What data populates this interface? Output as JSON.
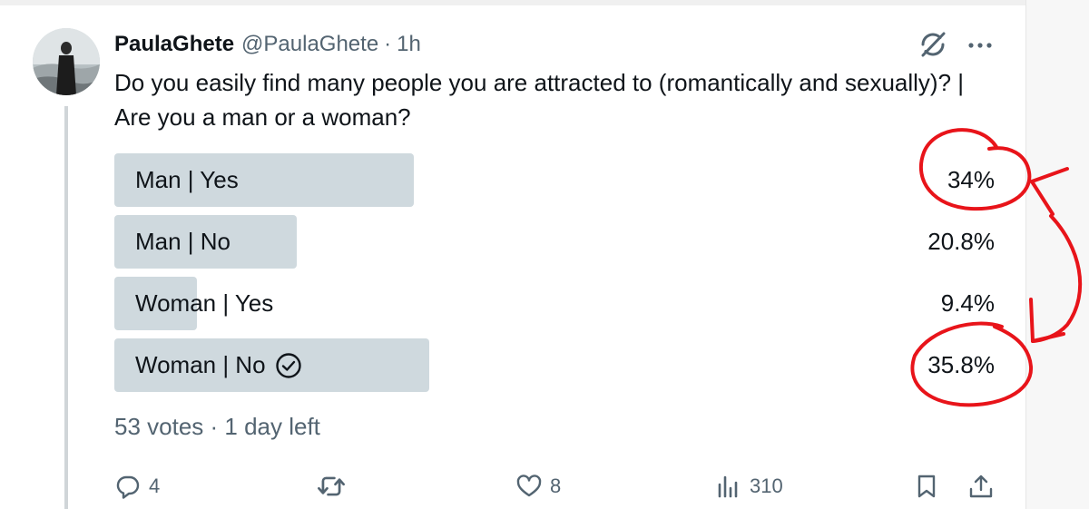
{
  "tweet": {
    "display_name": "PaulaGhete",
    "handle": "@PaulaGhete",
    "separator": "·",
    "time": "1h",
    "text": "Do you easily find many people you are attracted to (romantically and sexually)? | Are you a man or a woman?"
  },
  "poll": {
    "options": [
      {
        "label": "Man | Yes",
        "percent_text": "34%",
        "percent": 34.0
      },
      {
        "label": "Man | No",
        "percent_text": "20.8%",
        "percent": 20.8
      },
      {
        "label": "Woman | Yes",
        "percent_text": "9.4%",
        "percent": 9.4
      },
      {
        "label": "Woman | No",
        "percent_text": "35.8%",
        "percent": 35.8,
        "selected": true
      }
    ],
    "meta": "53 votes · 1 day left"
  },
  "actions": {
    "reply_count": "4",
    "like_count": "8",
    "views_count": "310"
  },
  "icons": {
    "grok": "grok-icon",
    "more": "more-icon",
    "reply": "reply-icon",
    "retweet": "retweet-icon",
    "like": "heart-icon",
    "views": "views-icon",
    "bookmark": "bookmark-icon",
    "share": "share-icon",
    "selected": "check-circle-icon"
  },
  "colors": {
    "poll_bar": "#cfd9de",
    "secondary_text": "#536471",
    "annotation": "#e8141a"
  }
}
